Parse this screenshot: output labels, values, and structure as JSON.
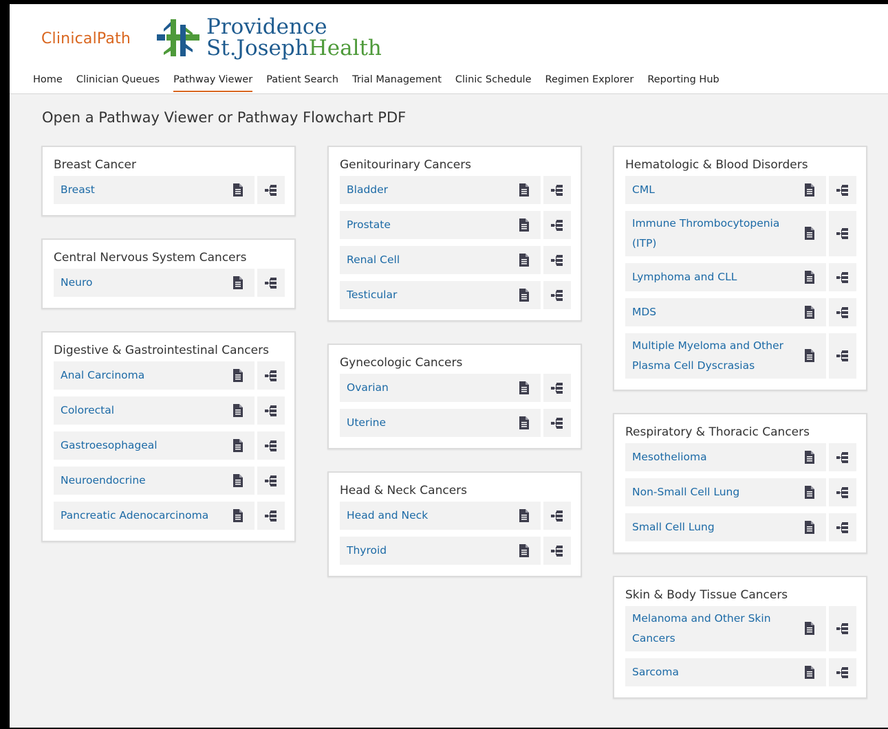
{
  "app": {
    "brand": "ClinicalPath",
    "logo_line1": "Providence",
    "logo_line2a": "St.Joseph",
    "logo_line2b": "Health"
  },
  "nav": {
    "items": [
      "Home",
      "Clinician Queues",
      "Pathway Viewer",
      "Patient Search",
      "Trial Management",
      "Clinic Schedule",
      "Regimen Explorer",
      "Reporting Hub"
    ],
    "active": "Pathway Viewer"
  },
  "page": {
    "title": "Open a Pathway Viewer or Pathway Flowchart PDF"
  },
  "icons": {
    "document": "document-icon",
    "flowchart": "flowchart-icon"
  },
  "colors": {
    "brand": "#d9661f",
    "link": "#1c6aa6",
    "icon": "#3f3f4e",
    "logo_blue": "#1e5b8f",
    "logo_green": "#4e9a3a"
  },
  "columns": [
    [
      {
        "title": "Breast Cancer",
        "items": [
          "Breast"
        ]
      },
      {
        "title": "Central Nervous System Cancers",
        "items": [
          "Neuro"
        ]
      },
      {
        "title": "Digestive & Gastrointestinal Cancers",
        "items": [
          "Anal Carcinoma",
          "Colorectal",
          "Gastroesophageal",
          "Neuroendocrine",
          "Pancreatic Adenocarcinoma"
        ]
      }
    ],
    [
      {
        "title": "Genitourinary Cancers",
        "items": [
          "Bladder",
          "Prostate",
          "Renal Cell",
          "Testicular"
        ]
      },
      {
        "title": "Gynecologic Cancers",
        "items": [
          "Ovarian",
          "Uterine"
        ]
      },
      {
        "title": "Head & Neck Cancers",
        "items": [
          "Head and Neck",
          "Thyroid"
        ]
      }
    ],
    [
      {
        "title": "Hematologic & Blood Disorders",
        "items": [
          "CML",
          "Immune Thrombocytopenia (ITP)",
          "Lymphoma and CLL",
          "MDS",
          "Multiple Myeloma and Other Plasma Cell Dyscrasias"
        ]
      },
      {
        "title": "Respiratory & Thoracic Cancers",
        "items": [
          "Mesothelioma",
          "Non-Small Cell Lung",
          "Small Cell Lung"
        ]
      },
      {
        "title": "Skin & Body Tissue Cancers",
        "items": [
          "Melanoma and Other Skin Cancers",
          "Sarcoma"
        ]
      }
    ]
  ]
}
